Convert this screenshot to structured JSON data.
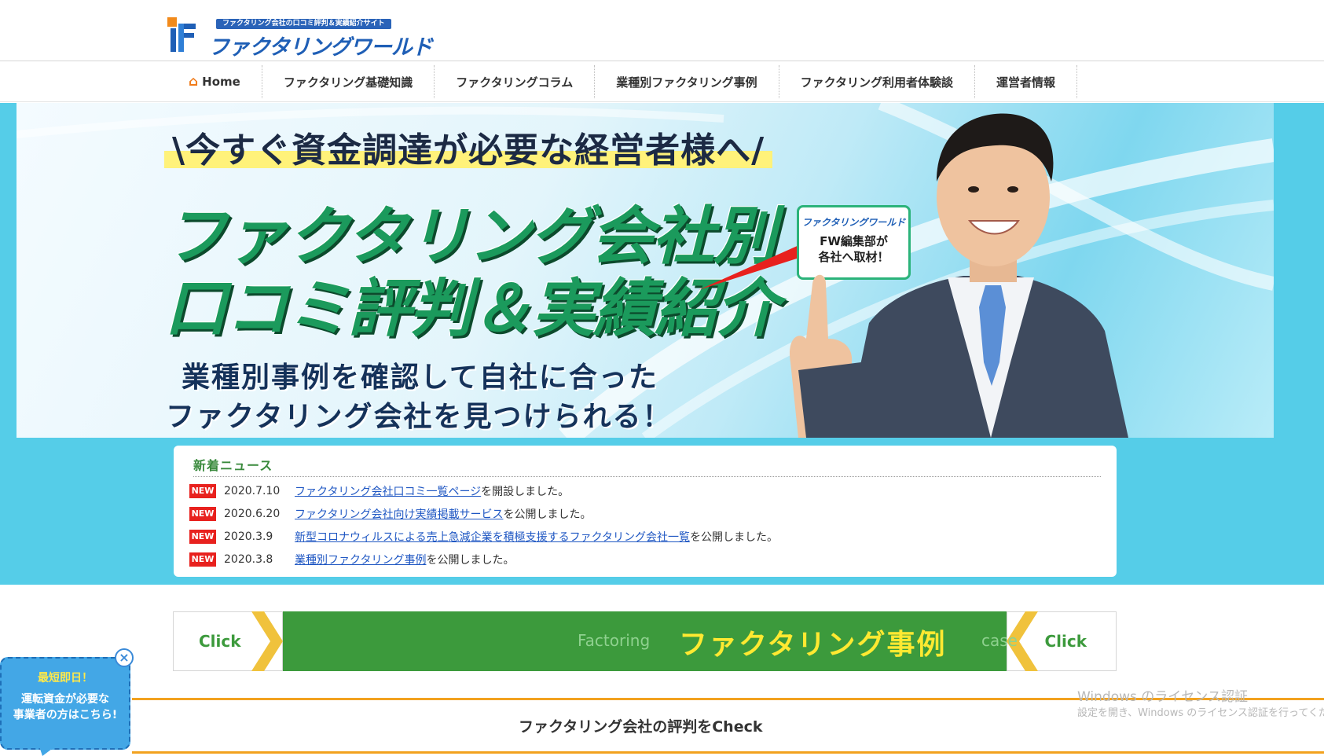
{
  "header": {
    "logo_tagline": "ファクタリング会社の口コミ評判＆実績紹介サイト",
    "logo_text": "ファクタリングワールド"
  },
  "nav": {
    "items": [
      {
        "label": "Home",
        "icon": "home-icon"
      },
      {
        "label": "ファクタリング基礎知識"
      },
      {
        "label": "ファクタリングコラム"
      },
      {
        "label": "業種別ファクタリング事例"
      },
      {
        "label": "ファクタリング利用者体験談"
      },
      {
        "label": "運営者情報"
      }
    ]
  },
  "hero": {
    "subtitle": "\\今すぐ資金調達が必要な経営者様へ/",
    "title_line1": "ファクタリング会社別",
    "title_line2": "口コミ評判＆実績紹介",
    "desc_line1": "業種別事例を確認して自社に合った",
    "desc_line2": "ファクタリング会社を見つけられる！",
    "badge_logo": "ファクタリングワールド",
    "badge_line1": "FW編集部が",
    "badge_line2": "各社へ取材！"
  },
  "news": {
    "title": "新着ニュース",
    "items": [
      {
        "badge": "NEW",
        "date": "2020.7.10",
        "link": "ファクタリング会社口コミ一覧ページ",
        "suffix": "を開設しました。"
      },
      {
        "badge": "NEW",
        "date": "2020.6.20",
        "link": "ファクタリング会社向け実績掲載サービス",
        "suffix": "を公開しました。"
      },
      {
        "badge": "NEW",
        "date": "2020.3.9",
        "link": "新型コロナウィルスによる売上急減企業を積極支援するファクタリング会社一覧",
        "suffix": "を公開しました。"
      },
      {
        "badge": "NEW",
        "date": "2020.3.8",
        "link": "業種別ファクタリング事例",
        "suffix": "を公開しました。"
      }
    ]
  },
  "case_banner": {
    "click_left": "Click",
    "click_right": "Click",
    "word_left": "Factoring",
    "title": "ファクタリング事例",
    "word_right": "case"
  },
  "section": {
    "title": "ファクタリング会社の評判をCheck"
  },
  "float_widget": {
    "head": "最短即日！",
    "line1": "運転資金が必要な",
    "line2": "事業者の方はこちら!",
    "close": "×"
  },
  "watermark": {
    "line1": "Windows のライセンス認証",
    "line2": "設定を開き、Windows のライセンス認証を行ってください。"
  },
  "colors": {
    "accent_blue": "#55cde8",
    "green": "#3c9a3c",
    "orange": "#f2a21f",
    "new_red": "#e8211e"
  }
}
